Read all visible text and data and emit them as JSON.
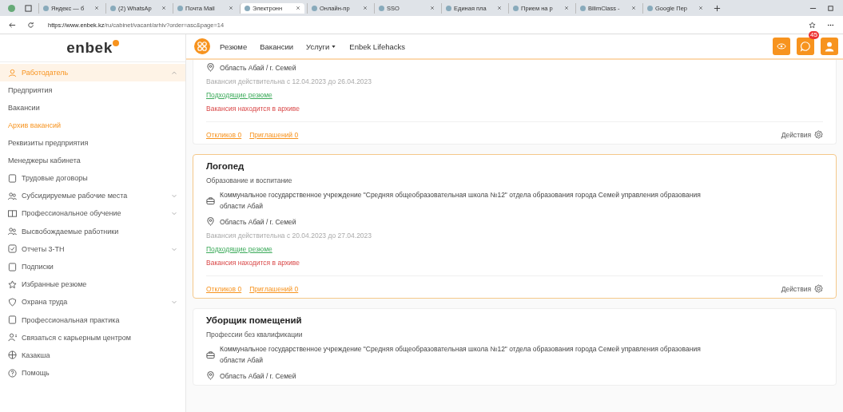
{
  "browser": {
    "tabs": [
      {
        "label": "Яндекс — б",
        "selected": false
      },
      {
        "label": "(2) WhatsAp",
        "selected": false
      },
      {
        "label": "Почта Mail",
        "selected": false
      },
      {
        "label": "Электронн",
        "selected": true
      },
      {
        "label": "Онлайн-пр",
        "selected": false
      },
      {
        "label": "SSO",
        "selected": false
      },
      {
        "label": "Единая пла",
        "selected": false
      },
      {
        "label": "Прием на р",
        "selected": false
      },
      {
        "label": "BilimClass -",
        "selected": false
      },
      {
        "label": "Google Пер",
        "selected": false
      }
    ],
    "address": {
      "domain": "https://www.enbek.kz",
      "path": "/ru/cabinet/vacant/arhiv?order=asc&page=14"
    }
  },
  "logo": "enbek",
  "sidebar": {
    "group": {
      "label": "Работодатель",
      "expanded": true,
      "children": [
        {
          "label": "Предприятия",
          "selected": false
        },
        {
          "label": "Вакансии",
          "selected": false
        },
        {
          "label": "Архив вакансий",
          "selected": true
        },
        {
          "label": "Реквизиты предприятия",
          "selected": false
        },
        {
          "label": "Менеджеры кабинета",
          "selected": false
        }
      ]
    },
    "items": [
      {
        "label": "Трудовые договоры",
        "kind": "doc",
        "expandable": false
      },
      {
        "label": "Субсидируемые рабочие места",
        "kind": "people",
        "expandable": true
      },
      {
        "label": "Профессиональное обучение",
        "kind": "book",
        "expandable": true
      },
      {
        "label": "Высвобождаемые работники",
        "kind": "people",
        "expandable": false
      },
      {
        "label": "Отчеты 3-ТН",
        "kind": "check",
        "expandable": true
      },
      {
        "label": "Подписки",
        "kind": "doc",
        "expandable": false
      },
      {
        "label": "Избранные резюме",
        "kind": "star",
        "expandable": false
      },
      {
        "label": "Охрана труда",
        "kind": "shield",
        "expandable": true
      },
      {
        "label": "Профессиональная практика",
        "kind": "doc",
        "expandable": false
      },
      {
        "label": "Связаться с карьерным центром",
        "kind": "person",
        "expandable": false
      },
      {
        "label": "Казакша",
        "kind": "globe",
        "expandable": false
      },
      {
        "label": "Помощь",
        "kind": "help",
        "expandable": false
      }
    ]
  },
  "nav": {
    "links": [
      {
        "label": "Резюме",
        "dropdown": false
      },
      {
        "label": "Вакансии",
        "dropdown": false
      },
      {
        "label": "Услуги",
        "dropdown": true
      },
      {
        "label": "Enbek Lifehacks",
        "dropdown": false
      }
    ],
    "badge": "45"
  },
  "vacancies": [
    {
      "highlighted": false,
      "location": "Область Абай / г. Семей",
      "validity": "Вакансия действительна с 12.04.2023 до 26.04.2023",
      "matching": "Подходящие резюме",
      "status": "Вакансия находится в архиве",
      "responses": "Откликов 0",
      "invitations": "Приглашений 0",
      "actions": "Действия"
    },
    {
      "highlighted": true,
      "title": "Логопед",
      "category": "Образование и воспитание",
      "organization": "Коммунальное государственное учреждение \"Средняя общеобразовательная школа №12\" отдела образования города Семей управления образования области Абай",
      "location": "Область Абай / г. Семей",
      "validity": "Вакансия действительна с 20.04.2023 до 27.04.2023",
      "matching": "Подходящие резюме",
      "status": "Вакансия находится в архиве",
      "responses": "Откликов 0",
      "invitations": "Приглашений 0",
      "actions": "Действия"
    },
    {
      "highlighted": false,
      "title": "Уборщик помещений",
      "category": "Профессии без квалификации",
      "organization": "Коммунальное государственное учреждение \"Средняя общеобразовательная школа №12\" отдела образования города Семей управления образования области Абай",
      "location": "Область Абай / г. Семей"
    }
  ]
}
